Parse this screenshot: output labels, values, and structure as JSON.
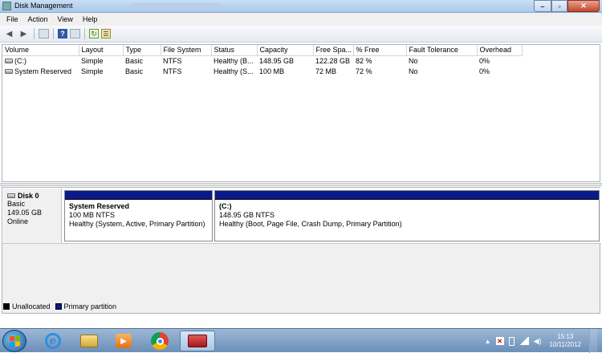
{
  "window": {
    "title": "Disk Management",
    "blurred_caption": "Need to Format Second Drive - I..."
  },
  "menu": [
    "File",
    "Action",
    "View",
    "Help"
  ],
  "columns": [
    "Volume",
    "Layout",
    "Type",
    "File System",
    "Status",
    "Capacity",
    "Free Spa...",
    "% Free",
    "Fault Tolerance",
    "Overhead"
  ],
  "volumes": [
    {
      "volume": "(C:)",
      "layout": "Simple",
      "type": "Basic",
      "fs": "NTFS",
      "status": "Healthy (B...",
      "capacity": "148.95 GB",
      "free": "122.28 GB",
      "pct": "82 %",
      "fault": "No",
      "overhead": "0%"
    },
    {
      "volume": "System Reserved",
      "layout": "Simple",
      "type": "Basic",
      "fs": "NTFS",
      "status": "Healthy (S...",
      "capacity": "100 MB",
      "free": "72 MB",
      "pct": "72 %",
      "fault": "No",
      "overhead": "0%"
    }
  ],
  "disk": {
    "name": "Disk 0",
    "type": "Basic",
    "size": "149.05 GB",
    "state": "Online",
    "partitions": [
      {
        "name": "System Reserved",
        "size": "100 MB NTFS",
        "status": "Healthy (System, Active, Primary Partition)"
      },
      {
        "name": "(C:)",
        "size": "148.95 GB NTFS",
        "status": "Healthy (Boot, Page File, Crash Dump, Primary Partition)"
      }
    ]
  },
  "legend": {
    "unallocated": "Unallocated",
    "primary": "Primary partition"
  },
  "colors": {
    "unallocated": "#000000",
    "primary": "#0a1a8c",
    "taskbar": "#7d9dc2"
  },
  "clock": {
    "time": "15:13",
    "date": "10/11/2012"
  },
  "icons": [
    "back-icon",
    "forward-icon",
    "console-tree-icon",
    "help-icon",
    "show-hide-icon",
    "refresh-icon",
    "properties-icon"
  ]
}
